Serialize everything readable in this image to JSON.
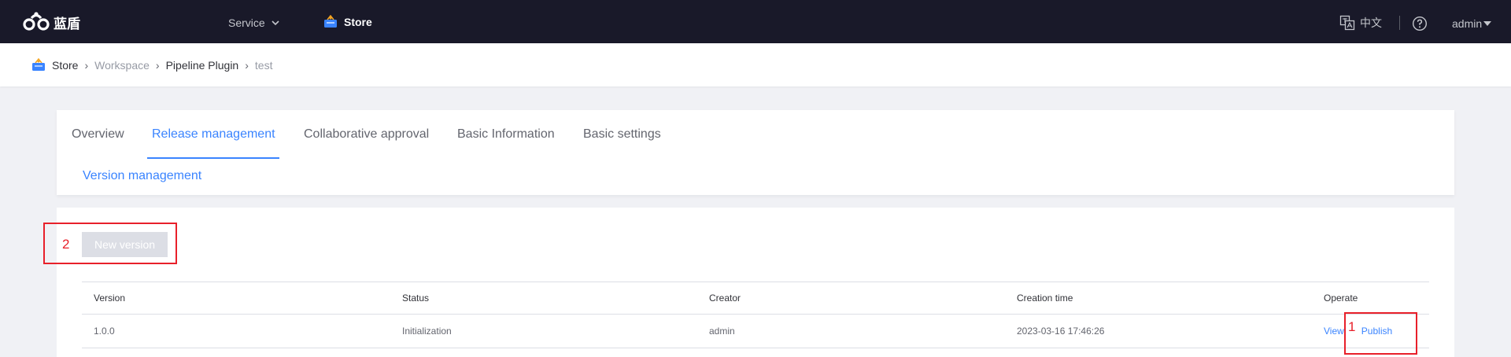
{
  "topnav": {
    "logo_text": "蓝盾",
    "service_label": "Service",
    "store_label": "Store",
    "lang_label": "中文",
    "user_label": "admin"
  },
  "breadcrumb": {
    "items": [
      "Store",
      "Workspace",
      "Pipeline Plugin",
      "test"
    ]
  },
  "tabs": {
    "items": [
      "Overview",
      "Release management",
      "Collaborative approval",
      "Basic Information",
      "Basic settings"
    ],
    "active": "Release management",
    "subtab": "Version management"
  },
  "content": {
    "new_version_label": "New version",
    "table": {
      "headers": [
        "Version",
        "Status",
        "Creator",
        "Creation time",
        "Operate"
      ],
      "rows": [
        {
          "version": "1.0.0",
          "status": "Initialization",
          "creator": "admin",
          "creation_time": "2023-03-16 17:46:26",
          "operations": [
            "View",
            "Publish"
          ]
        }
      ]
    }
  },
  "annotations": {
    "label_1": "1",
    "label_2": "2"
  },
  "colors": {
    "nav_bg": "#191929",
    "accent": "#3a84ff",
    "annotation": "#e8202a",
    "disabled_button": "#dcdee5"
  }
}
